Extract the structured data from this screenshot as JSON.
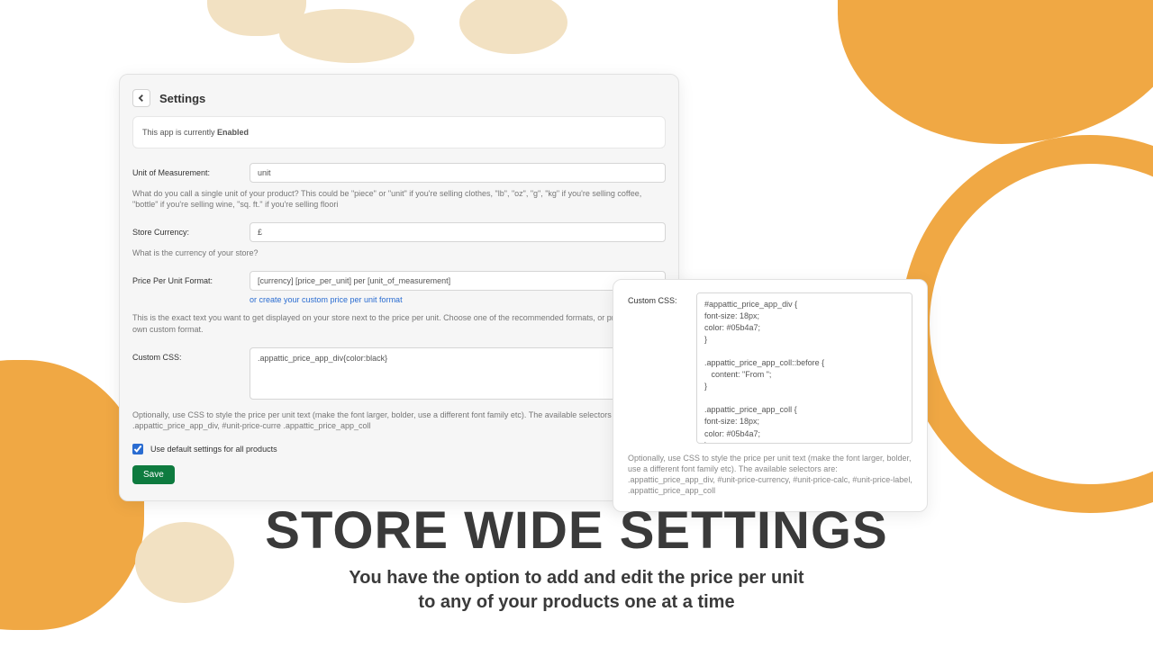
{
  "settings": {
    "title": "Settings",
    "status_prefix": "This app is currently ",
    "status_value": "Enabled",
    "unit_label": "Unit of Measurement:",
    "unit_value": "unit",
    "unit_help": "What do you call a single unit of your product? This could be \"piece\" or \"unit\" if you're selling clothes, \"lb\", \"oz\", \"g\", \"kg\" if you're selling coffee, \"bottle\" if you're selling wine, \"sq. ft.\" if you're selling floori",
    "currency_label": "Store Currency:",
    "currency_value": "£",
    "currency_help": "What is the currency of your store?",
    "format_label": "Price Per Unit Format:",
    "format_value": "[currency] [price_per_unit] per [unit_of_measurement]",
    "format_link": "or create your custom price per unit format",
    "format_help": "This is the exact text you want to get displayed on your store next to the price per unit. Choose one of the recommended formats, or provide your own custom format.",
    "css_label": "Custom CSS:",
    "css_value": ".appattic_price_app_div{color:black}",
    "css_help": "Optionally, use CSS to style the price per unit text (make the font larger, bolder, use a different font family etc). The available selectors are: .appattic_price_app_div, #unit-price-curre .appattic_price_app_coll",
    "checkbox_label": "Use default settings for all products",
    "save_label": "Save"
  },
  "side": {
    "label": "Custom CSS:",
    "css": "#appattic_price_app_div {\nfont-size: 18px;\ncolor: #05b4a7;\n}\n\n.appattic_price_app_coll::before {\n   content: \"From \";\n}\n\n.appattic_price_app_coll {\nfont-size: 18px;\ncolor: #05b4a7;\n}",
    "help": "Optionally, use CSS to style the price per unit text (make the font larger, bolder, use a different font family etc). The available selectors are: .appattic_price_app_div, #unit-price-currency, #unit-price-calc, #unit-price-label, .appattic_price_app_coll"
  },
  "hero": {
    "title": "STORE WIDE SETTINGS",
    "sub1": "You have the option to add and edit the price per unit",
    "sub2": "to any of your products one at a time"
  }
}
